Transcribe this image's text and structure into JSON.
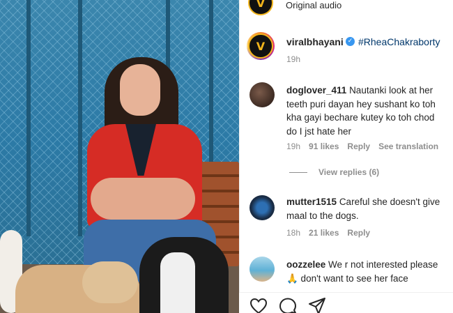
{
  "header": {
    "audio_label": "Original audio"
  },
  "caption": {
    "username": "viralbhayani",
    "hashtag": "#RheaChakraborty",
    "time": "19h"
  },
  "comments": [
    {
      "username": "doglover_411",
      "text": "Nautanki look at her teeth puri dayan hey sushant ko toh kha gayi bechare kutey ko toh chod do I jst hate her",
      "time": "19h",
      "likes": "91 likes",
      "reply": "Reply",
      "translate": "See translation"
    },
    {
      "username": "mutter1515",
      "text": "Careful she doesn't give maal to the dogs.",
      "time": "18h",
      "likes": "21 likes",
      "reply": "Reply"
    },
    {
      "username": "oozzelee",
      "text": "We r not interested please 🙏 don't want to see her face"
    }
  ],
  "view_replies": "View replies (6)",
  "icons": {
    "verified": "verified-badge-icon",
    "like": "heart-icon",
    "comment": "comment-icon",
    "share": "share-icon"
  },
  "colors": {
    "link": "#00376b",
    "verified": "#3897f0",
    "muted": "#8e8e8e"
  }
}
